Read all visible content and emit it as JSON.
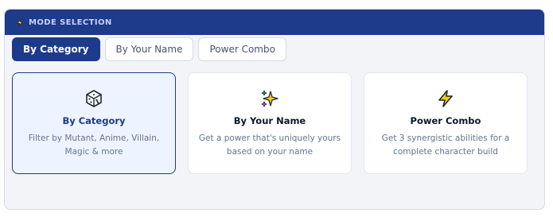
{
  "section": {
    "title": "MODE SELECTION",
    "icon": "lightning-bolt-icon"
  },
  "tabs": [
    {
      "label": "By Category",
      "active": true
    },
    {
      "label": "By Your Name",
      "active": false
    },
    {
      "label": "Power Combo",
      "active": false
    }
  ],
  "cards": [
    {
      "icon": "dice-icon",
      "title": "By Category",
      "description": "Filter by Mutant, Anime, Villain, Magic & more",
      "selected": true
    },
    {
      "icon": "sparkles-icon",
      "title": "By Your Name",
      "description": "Get a power that's uniquely yours based on your name",
      "selected": false
    },
    {
      "icon": "lightning-bolt-icon",
      "title": "Power Combo",
      "description": "Get 3 synergistic abilities for a complete character build",
      "selected": false
    }
  ],
  "colors": {
    "header_bg": "#1e3a8a",
    "accent": "#1e3a8a",
    "selected_card_bg": "#eef4ff",
    "bolt_yellow": "#facc15"
  }
}
